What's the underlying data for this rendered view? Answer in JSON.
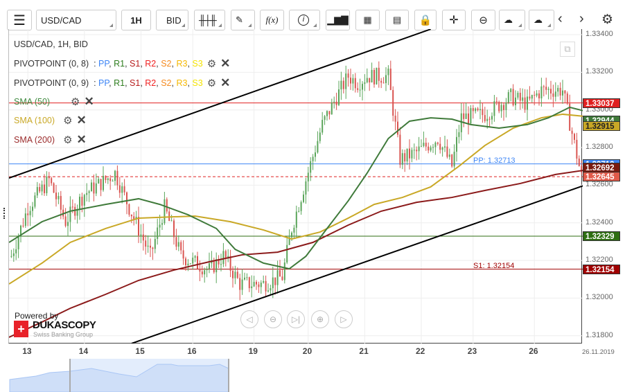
{
  "toolbar": {
    "symbol": "USD/CAD",
    "timeframe": "1H",
    "side": "BID",
    "fx_label": "f(x)"
  },
  "legend": {
    "title": "USD/CAD, 1H, BID",
    "pivots": [
      {
        "label": "PIVOTPOINT (0, 8)"
      },
      {
        "label": "PIVOTPOINT (0, 9)"
      }
    ],
    "pivot_sep": ":",
    "pivot_levels": [
      {
        "t": "PP",
        "c": "#3d85f5"
      },
      {
        "t": "R1",
        "c": "#2e7d1e"
      },
      {
        "t": "S1",
        "c": "#b71c1c"
      },
      {
        "t": "R2",
        "c": "#f02020"
      },
      {
        "t": "S2",
        "c": "#f58a1f"
      },
      {
        "t": "R3",
        "c": "#f5b800"
      },
      {
        "t": "S3",
        "c": "#f5e400"
      }
    ],
    "smas": [
      {
        "label": "SMA (50)",
        "color": "#3f8a3f"
      },
      {
        "label": "SMA (100)",
        "color": "#c9a826"
      },
      {
        "label": "SMA (200)",
        "color": "#9b2b2b"
      }
    ]
  },
  "branding": {
    "powered": "Powered by",
    "name": "DUKASCOPY",
    "tagline": "Swiss Banking Group"
  },
  "axis": {
    "prices": [
      "1.33400",
      "1.33200",
      "1.33000",
      "1.32800",
      "1.32600",
      "1.32400",
      "1.32200",
      "1.32000",
      "1.31800"
    ],
    "dates": [
      {
        "t": "13",
        "h": 8
      },
      {
        "t": "14",
        "h": 32
      },
      {
        "t": "15",
        "h": 56
      },
      {
        "t": "16",
        "h": 78
      },
      {
        "t": "19",
        "h": 104
      },
      {
        "t": "20",
        "h": 127
      },
      {
        "t": "21",
        "h": 151
      },
      {
        "t": "22",
        "h": 175
      },
      {
        "t": "23",
        "h": 197
      },
      {
        "t": "26",
        "h": 223
      }
    ],
    "current_date": "26.11.2019"
  },
  "tags": [
    {
      "v": "1.33037",
      "c": "#e02020"
    },
    {
      "v": "1.32944",
      "c": "#3f7a3a"
    },
    {
      "v": "1.32915",
      "c": "#c9a826",
      "fg": "#222"
    },
    {
      "v": "1.32713",
      "c": "#3d85f5"
    },
    {
      "v": "1.32692",
      "c": "#7a1a10"
    },
    {
      "v": "1.32645",
      "c": "#e05a4a"
    },
    {
      "v": "1.32329",
      "c": "#2e6e12"
    },
    {
      "v": "1.32154",
      "c": "#a00000"
    }
  ],
  "levels": {
    "pp_label": "PP: 1.32713",
    "s1_label": "S1: 1.32154"
  },
  "chart_data": {
    "type": "candlestick",
    "ylim": [
      1.31759,
      1.33429
    ],
    "price_path": [
      [
        0,
        1.3222
      ],
      [
        1,
        1.32224
      ],
      [
        8,
        1.32481
      ],
      [
        17,
        1.32628
      ],
      [
        24,
        1.32407
      ],
      [
        32,
        1.32554
      ],
      [
        41,
        1.32628
      ],
      [
        45,
        1.32665
      ],
      [
        51,
        1.32481
      ],
      [
        60,
        1.32224
      ],
      [
        66,
        1.32481
      ],
      [
        73,
        1.32224
      ],
      [
        85,
        1.3215
      ],
      [
        91,
        1.32224
      ],
      [
        98,
        1.32076
      ],
      [
        108,
        1.32076
      ],
      [
        116,
        1.32113
      ],
      [
        120,
        1.32371
      ],
      [
        126,
        1.32628
      ],
      [
        133,
        1.32922
      ],
      [
        139,
        1.33069
      ],
      [
        144,
        1.33179
      ],
      [
        148,
        1.33143
      ],
      [
        152,
        1.33179
      ],
      [
        161,
        1.33179
      ],
      [
        166,
        1.32738
      ],
      [
        173,
        1.32775
      ],
      [
        182,
        1.32849
      ],
      [
        188,
        1.32701
      ],
      [
        192,
        1.32959
      ],
      [
        202,
        1.32977
      ],
      [
        213,
        1.33069
      ],
      [
        220,
        1.33032
      ],
      [
        226,
        1.33106
      ],
      [
        235,
        1.33106
      ],
      [
        243,
        1.32645
      ]
    ],
    "sma50": [
      [
        0,
        1.32296
      ],
      [
        14,
        1.32406
      ],
      [
        26,
        1.32462
      ],
      [
        41,
        1.32498
      ],
      [
        55,
        1.32528
      ],
      [
        64,
        1.32498
      ],
      [
        76,
        1.32443
      ],
      [
        88,
        1.3237
      ],
      [
        96,
        1.32259
      ],
      [
        108,
        1.32186
      ],
      [
        119,
        1.32156
      ],
      [
        126,
        1.32222
      ],
      [
        135,
        1.3237
      ],
      [
        144,
        1.32517
      ],
      [
        152,
        1.32664
      ],
      [
        161,
        1.32848
      ],
      [
        170,
        1.3294
      ],
      [
        179,
        1.32958
      ],
      [
        188,
        1.32951
      ],
      [
        196,
        1.32922
      ],
      [
        208,
        1.32903
      ],
      [
        220,
        1.32922
      ],
      [
        229,
        1.32958
      ],
      [
        238,
        1.33014
      ],
      [
        244,
        1.32995
      ]
    ],
    "sma100": [
      [
        0,
        1.32075
      ],
      [
        14,
        1.32186
      ],
      [
        26,
        1.32296
      ],
      [
        41,
        1.3237
      ],
      [
        55,
        1.32425
      ],
      [
        79,
        1.32436
      ],
      [
        94,
        1.32406
      ],
      [
        108,
        1.32362
      ],
      [
        120,
        1.32314
      ],
      [
        132,
        1.32351
      ],
      [
        144,
        1.32425
      ],
      [
        155,
        1.32498
      ],
      [
        167,
        1.32535
      ],
      [
        179,
        1.32591
      ],
      [
        191,
        1.32701
      ],
      [
        202,
        1.32811
      ],
      [
        214,
        1.32903
      ],
      [
        226,
        1.32958
      ],
      [
        235,
        1.32977
      ],
      [
        244,
        1.32966
      ]
    ],
    "sma200": [
      [
        0,
        1.31792
      ],
      [
        14,
        1.31873
      ],
      [
        26,
        1.31946
      ],
      [
        41,
        1.3202
      ],
      [
        55,
        1.32094
      ],
      [
        70,
        1.32149
      ],
      [
        85,
        1.32193
      ],
      [
        99,
        1.3223
      ],
      [
        114,
        1.32244
      ],
      [
        129,
        1.32296
      ],
      [
        144,
        1.32388
      ],
      [
        158,
        1.32462
      ],
      [
        173,
        1.32509
      ],
      [
        188,
        1.32535
      ],
      [
        202,
        1.32572
      ],
      [
        217,
        1.32609
      ],
      [
        232,
        1.32657
      ],
      [
        244,
        1.32679
      ]
    ],
    "channel_upper": [
      [
        0,
        1.32638
      ],
      [
        179,
        1.33429
      ]
    ],
    "channel_lower": [
      [
        52,
        1.31759
      ],
      [
        244,
        1.32598
      ]
    ],
    "hlines": [
      {
        "p": 1.33037,
        "c": "#e02020"
      },
      {
        "p": 1.32713,
        "c": "#3d85f5"
      },
      {
        "p": 1.32645,
        "c": "#e02020",
        "dash": true
      },
      {
        "p": 1.32329,
        "c": "#2e6e12"
      },
      {
        "p": 1.32154,
        "c": "#a00000"
      }
    ]
  }
}
